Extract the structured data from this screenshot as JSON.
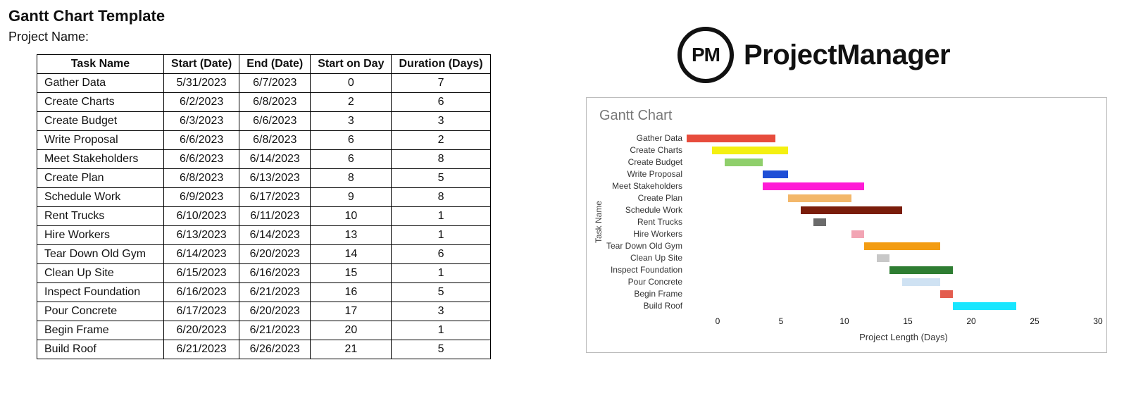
{
  "header": {
    "title": "Gantt Chart Template",
    "project_label": "Project Name:"
  },
  "logo": {
    "badge": "PM",
    "word": "ProjectManager"
  },
  "table": {
    "columns": [
      "Task Name",
      "Start (Date)",
      "End (Date)",
      "Start on Day",
      "Duration (Days)"
    ],
    "rows": [
      {
        "name": "Gather Data",
        "start": "5/31/2023",
        "end": "6/7/2023",
        "start_day": 0,
        "duration": 7
      },
      {
        "name": "Create Charts",
        "start": "6/2/2023",
        "end": "6/8/2023",
        "start_day": 2,
        "duration": 6
      },
      {
        "name": "Create Budget",
        "start": "6/3/2023",
        "end": "6/6/2023",
        "start_day": 3,
        "duration": 3
      },
      {
        "name": "Write Proposal",
        "start": "6/6/2023",
        "end": "6/8/2023",
        "start_day": 6,
        "duration": 2
      },
      {
        "name": "Meet Stakeholders",
        "start": "6/6/2023",
        "end": "6/14/2023",
        "start_day": 6,
        "duration": 8
      },
      {
        "name": "Create Plan",
        "start": "6/8/2023",
        "end": "6/13/2023",
        "start_day": 8,
        "duration": 5
      },
      {
        "name": "Schedule Work",
        "start": "6/9/2023",
        "end": "6/17/2023",
        "start_day": 9,
        "duration": 8
      },
      {
        "name": "Rent Trucks",
        "start": "6/10/2023",
        "end": "6/11/2023",
        "start_day": 10,
        "duration": 1
      },
      {
        "name": "Hire Workers",
        "start": "6/13/2023",
        "end": "6/14/2023",
        "start_day": 13,
        "duration": 1
      },
      {
        "name": "Tear Down Old Gym",
        "start": "6/14/2023",
        "end": "6/20/2023",
        "start_day": 14,
        "duration": 6
      },
      {
        "name": "Clean Up Site",
        "start": "6/15/2023",
        "end": "6/16/2023",
        "start_day": 15,
        "duration": 1
      },
      {
        "name": "Inspect Foundation",
        "start": "6/16/2023",
        "end": "6/21/2023",
        "start_day": 16,
        "duration": 5
      },
      {
        "name": "Pour Concrete",
        "start": "6/17/2023",
        "end": "6/20/2023",
        "start_day": 17,
        "duration": 3
      },
      {
        "name": "Begin Frame",
        "start": "6/20/2023",
        "end": "6/21/2023",
        "start_day": 20,
        "duration": 1
      },
      {
        "name": "Build Roof",
        "start": "6/21/2023",
        "end": "6/26/2023",
        "start_day": 21,
        "duration": 5
      }
    ]
  },
  "chart_data": {
    "type": "bar",
    "orientation": "horizontal-gantt",
    "title": "Gantt Chart",
    "xlabel": "Project Length (Days)",
    "ylabel": "Task Name",
    "xlim": [
      0,
      30
    ],
    "xticks": [
      0,
      5,
      10,
      15,
      20,
      25,
      30
    ],
    "categories": [
      "Gather Data",
      "Create Charts",
      "Create Budget",
      "Write Proposal",
      "Meet Stakeholders",
      "Create Plan",
      "Schedule Work",
      "Rent Trucks",
      "Hire Workers",
      "Tear Down Old Gym",
      "Clean Up Site",
      "Inspect Foundation",
      "Pour Concrete",
      "Begin Frame",
      "Build Roof"
    ],
    "series": [
      {
        "name": "Gather Data",
        "start": 0,
        "duration": 7,
        "color": "#e74c3c"
      },
      {
        "name": "Create Charts",
        "start": 2,
        "duration": 6,
        "color": "#f4f011"
      },
      {
        "name": "Create Budget",
        "start": 3,
        "duration": 3,
        "color": "#8fcf6b"
      },
      {
        "name": "Write Proposal",
        "start": 6,
        "duration": 2,
        "color": "#1f4fd6"
      },
      {
        "name": "Meet Stakeholders",
        "start": 6,
        "duration": 8,
        "color": "#ff1bd6"
      },
      {
        "name": "Create Plan",
        "start": 8,
        "duration": 5,
        "color": "#f3b76a"
      },
      {
        "name": "Schedule Work",
        "start": 9,
        "duration": 8,
        "color": "#7a1d0b"
      },
      {
        "name": "Rent Trucks",
        "start": 10,
        "duration": 1,
        "color": "#6b6b6b"
      },
      {
        "name": "Hire Workers",
        "start": 13,
        "duration": 1,
        "color": "#f2a5b4"
      },
      {
        "name": "Tear Down Old Gym",
        "start": 14,
        "duration": 6,
        "color": "#f39c12"
      },
      {
        "name": "Clean Up Site",
        "start": 15,
        "duration": 1,
        "color": "#c8c8c8"
      },
      {
        "name": "Inspect Foundation",
        "start": 16,
        "duration": 5,
        "color": "#2e7d32"
      },
      {
        "name": "Pour Concrete",
        "start": 17,
        "duration": 3,
        "color": "#cfe2f3"
      },
      {
        "name": "Begin Frame",
        "start": 20,
        "duration": 1,
        "color": "#e35d4f"
      },
      {
        "name": "Build Roof",
        "start": 21,
        "duration": 5,
        "color": "#18e6ff"
      }
    ]
  }
}
